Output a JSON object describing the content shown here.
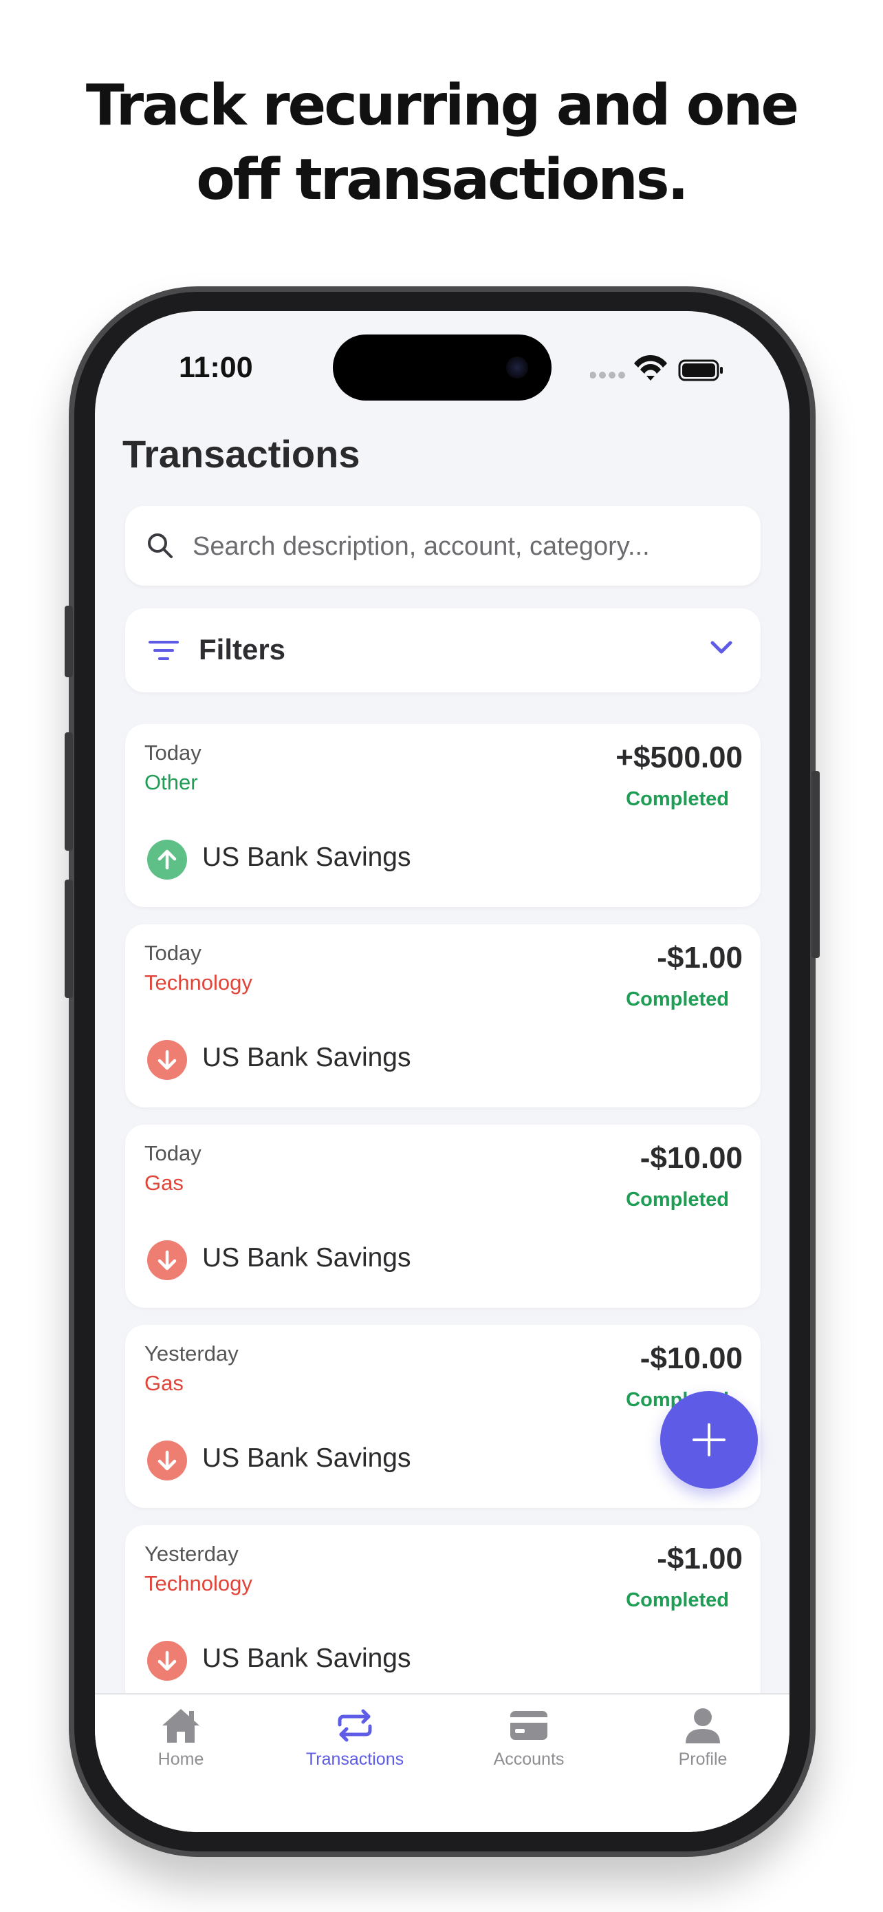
{
  "marketing": {
    "headline_line1": "Track recurring and one",
    "headline_line2": "off transactions."
  },
  "status_bar": {
    "time": "11:00"
  },
  "screen": {
    "title": "Transactions",
    "search": {
      "placeholder": "Search description, account, category..."
    },
    "filters": {
      "label": "Filters"
    }
  },
  "transactions": [
    {
      "date": "Today",
      "category": "Other",
      "category_color": "#1f9d55",
      "amount": "+$500.00",
      "status": "Completed",
      "account": "US Bank Savings",
      "direction": "income",
      "icon_color": "#5ec086"
    },
    {
      "date": "Today",
      "category": "Technology",
      "category_color": "#e0453a",
      "amount": "-$1.00",
      "status": "Completed",
      "account": "US Bank Savings",
      "direction": "expense",
      "icon_color": "#ef7e72"
    },
    {
      "date": "Today",
      "category": "Gas",
      "category_color": "#e0453a",
      "amount": "-$10.00",
      "status": "Completed",
      "account": "US Bank Savings",
      "direction": "expense",
      "icon_color": "#ef7e72"
    },
    {
      "date": "Yesterday",
      "category": "Gas",
      "category_color": "#e0453a",
      "amount": "-$10.00",
      "status": "Completed",
      "account": "US Bank Savings",
      "direction": "expense",
      "icon_color": "#ef7e72"
    },
    {
      "date": "Yesterday",
      "category": "Technology",
      "category_color": "#e0453a",
      "amount": "-$1.00",
      "status": "Completed",
      "account": "US Bank Savings",
      "direction": "expense",
      "icon_color": "#ef7e72"
    }
  ],
  "tabs": [
    {
      "label": "Home",
      "icon": "home-icon"
    },
    {
      "label": "Transactions",
      "icon": "repeat-icon",
      "active": true
    },
    {
      "label": "Accounts",
      "icon": "card-icon"
    },
    {
      "label": "Profile",
      "icon": "person-icon"
    }
  ],
  "colors": {
    "accent": "#5e5ce6",
    "income": "#1f9d55",
    "expense": "#e0453a",
    "screen_bg": "#f4f5f9"
  }
}
